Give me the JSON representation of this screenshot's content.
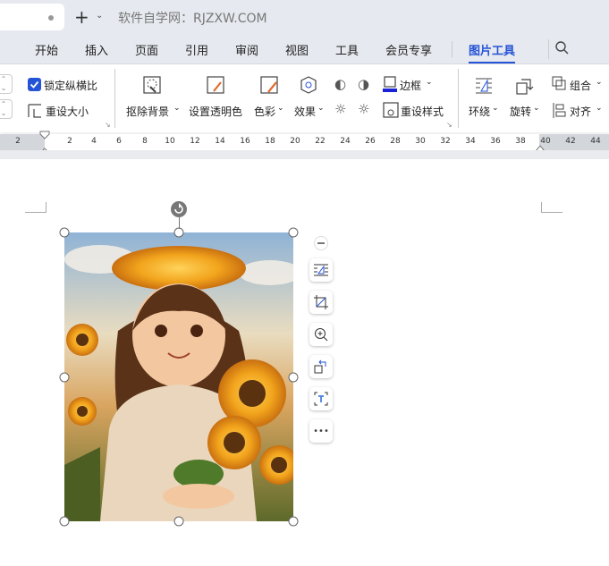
{
  "titlebar": {
    "site_text": "软件自学网：RJZXW.COM"
  },
  "menu": [
    "开始",
    "插入",
    "页面",
    "引用",
    "审阅",
    "视图",
    "工具",
    "会员专享",
    "图片工具"
  ],
  "active_menu": "图片工具",
  "ribbon": {
    "lock_aspect": "锁定纵横比",
    "reset_size": "重设大小",
    "remove_bg": "抠除背景",
    "set_transparent": "设置透明色",
    "color": "色彩",
    "effects": "效果",
    "border": "边框",
    "reset_style": "重设样式",
    "wrap": "环绕",
    "rotate": "旋转",
    "group": "组合",
    "align": "对齐"
  },
  "ruler_ticks": [
    "2",
    "2",
    "4",
    "6",
    "8",
    "10",
    "12",
    "14",
    "16",
    "18",
    "20",
    "22",
    "24",
    "26",
    "28",
    "30",
    "32",
    "34",
    "36",
    "38",
    "40",
    "42",
    "44"
  ],
  "colors": {
    "accent": "#2453d6",
    "border_color": "#1a22d8"
  }
}
